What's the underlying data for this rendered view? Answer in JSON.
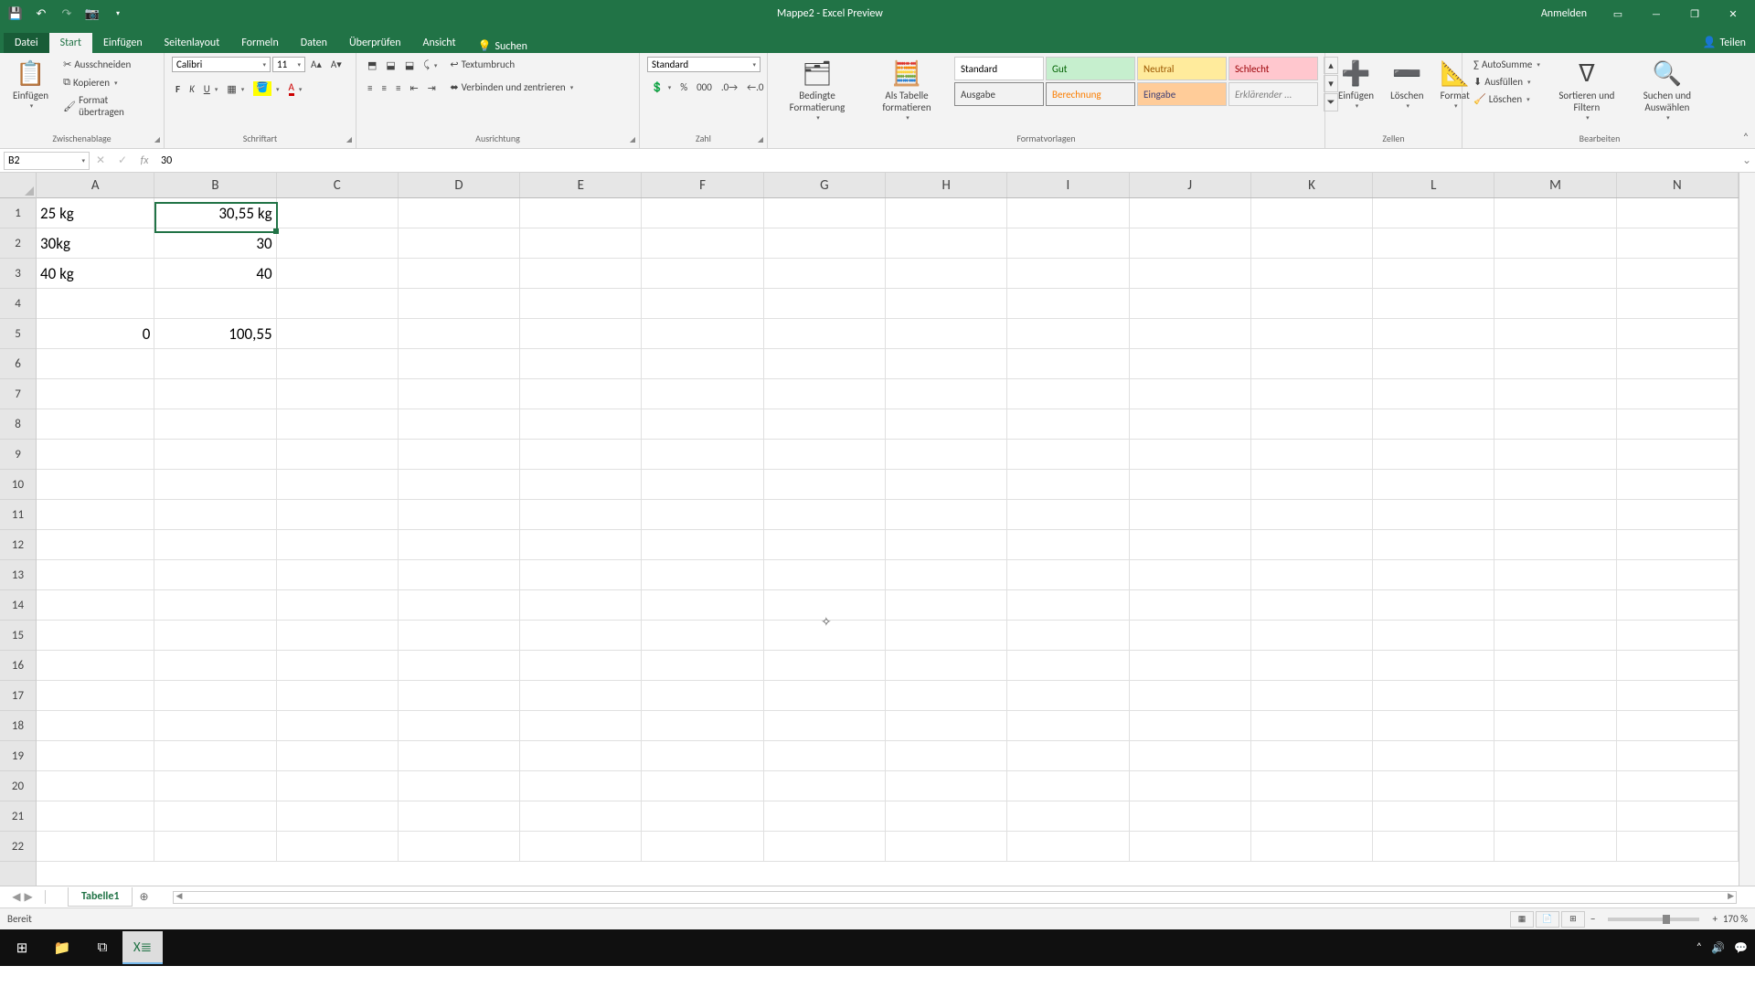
{
  "titlebar": {
    "title": "Mappe2  -  Excel Preview",
    "anmelden": "Anmelden"
  },
  "tabs": {
    "file": "Datei",
    "start": "Start",
    "einfuegen": "Einfügen",
    "layout": "Seitenlayout",
    "formeln": "Formeln",
    "daten": "Daten",
    "pruefen": "Überprüfen",
    "ansicht": "Ansicht",
    "suchen": "Suchen",
    "teilen": "Teilen"
  },
  "ribbon": {
    "paste_big": "Einfügen",
    "clipboard": {
      "cut": "Ausschneiden",
      "copy": "Kopieren",
      "format": "Format übertragen",
      "label": "Zwischenablage"
    },
    "font": {
      "name": "Calibri",
      "size": "11",
      "label": "Schriftart"
    },
    "align": {
      "wrap": "Textumbruch",
      "merge": "Verbinden und zentrieren",
      "label": "Ausrichtung"
    },
    "number": {
      "format": "Standard",
      "label": "Zahl"
    },
    "styles": {
      "cond": "Bedingte Formatierung",
      "table": "Als Tabelle formatieren",
      "s1": "Standard",
      "s2": "Gut",
      "s3": "Neutral",
      "s4": "Schlecht",
      "s5": "Ausgabe",
      "s6": "Berechnung",
      "s7": "Eingabe",
      "s8": "Erklärender ...",
      "label": "Formatvorlagen"
    },
    "cells": {
      "ins": "Einfügen",
      "del": "Löschen",
      "fmt": "Format",
      "label": "Zellen"
    },
    "edit": {
      "sum": "AutoSumme",
      "fill": "Ausfüllen",
      "clear": "Löschen",
      "sort": "Sortieren und Filtern",
      "find": "Suchen und Auswählen",
      "label": "Bearbeiten"
    }
  },
  "fbar": {
    "name": "B2",
    "value": "30"
  },
  "columns": [
    "A",
    "B",
    "C",
    "D",
    "E",
    "F",
    "G",
    "H",
    "I",
    "J",
    "K",
    "L",
    "M",
    "N"
  ],
  "cell_data": {
    "A1": "25 kg",
    "B1": "30,55 kg",
    "A2": "30kg",
    "B2": "30",
    "A3": "40 kg",
    "B3": "40",
    "A5": "0",
    "B5": "100,55"
  },
  "sheetTabs": {
    "name": "Tabelle1"
  },
  "status": {
    "ready": "Bereit",
    "zoom": "170 %"
  },
  "chart_data": {
    "type": "table",
    "title": "Worksheet cell values",
    "columns": [
      "A",
      "B"
    ],
    "rows": [
      {
        "A": "25 kg",
        "B": "30,55 kg"
      },
      {
        "A": "30kg",
        "B": "30"
      },
      {
        "A": "40 kg",
        "B": "40"
      },
      {
        "A": "",
        "B": ""
      },
      {
        "A": "0",
        "B": "100,55"
      }
    ]
  }
}
